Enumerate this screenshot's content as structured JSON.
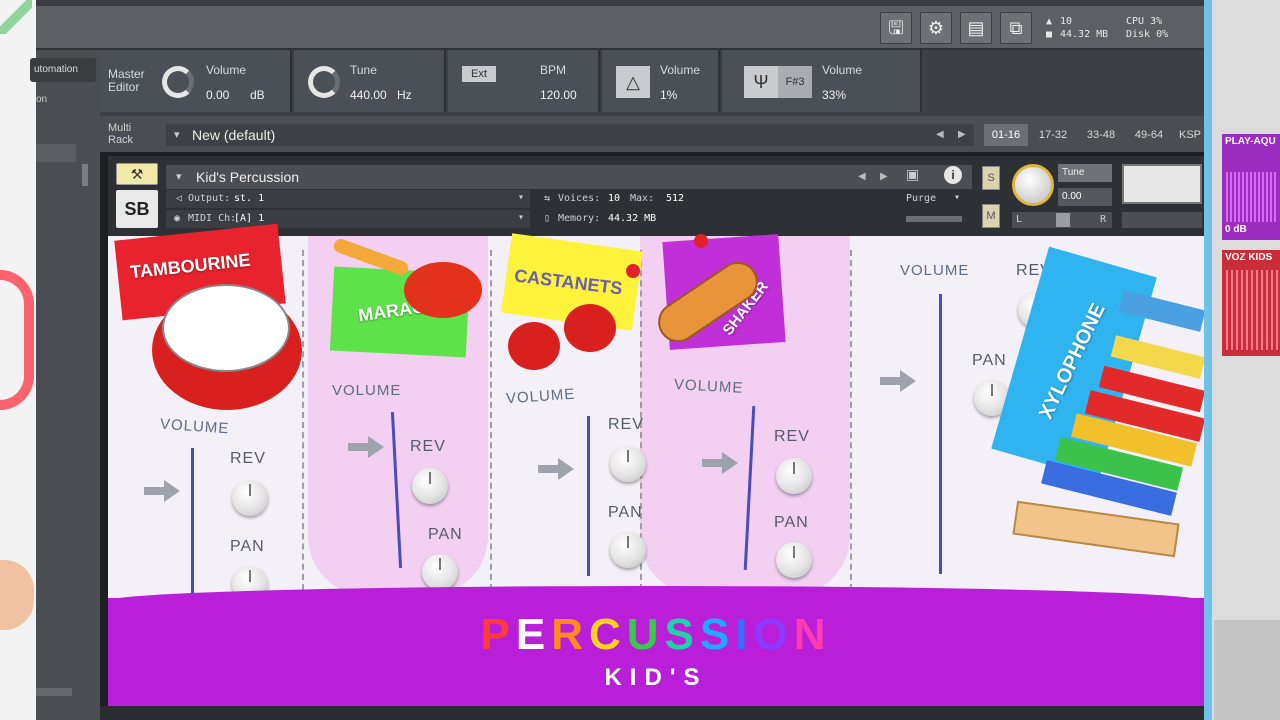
{
  "left": {
    "tab_label": "utomation",
    "sub_label": "on"
  },
  "topbar": {
    "voices_label": "10",
    "memory_label": "44.32 MB",
    "cpu_label": "CPU 3%",
    "disk_label": "Disk 0%"
  },
  "master": {
    "editor_label": "Master Editor",
    "volume_label": "Volume",
    "volume_value": "0.00",
    "volume_unit": "dB",
    "tune_label": "Tune",
    "tune_value": "440.00",
    "tune_unit": "Hz",
    "ext_label": "Ext",
    "bpm_label": "BPM",
    "bpm_value": "120.00",
    "metronome_volume_label": "Volume",
    "metronome_volume_value": "1%",
    "reference_key": "F#3",
    "reference_volume_label": "Volume",
    "reference_volume_value": "33%"
  },
  "rack": {
    "label": "Multi Rack",
    "name": "New (default)",
    "tabs": [
      "01-16",
      "17-32",
      "33-48",
      "49-64",
      "KSP"
    ]
  },
  "instrument": {
    "name": "Kid's Percussion",
    "output_label": "Output:",
    "output_value": "st. 1",
    "voices_label": "Voices:",
    "voices_value": "10",
    "max_label": "Max:",
    "max_value": "512",
    "midi_label": "MIDI Ch:",
    "midi_value": "[A] 1",
    "memory_label": "Memory:",
    "memory_value": "44.32 MB",
    "purge_label": "Purge",
    "solo_label": "S",
    "mute_label": "M",
    "tune_label": "Tune",
    "tune_value": "0.00",
    "left_label": "L",
    "right_label": "R"
  },
  "channels": [
    {
      "name": "TAMBOURINE",
      "volume_label": "VOLUME",
      "rev_label": "REV",
      "pan_label": "PAN"
    },
    {
      "name": "MARACA",
      "volume_label": "VOLUME",
      "rev_label": "REV",
      "pan_label": "PAN"
    },
    {
      "name": "CASTANETS",
      "volume_label": "VOLUME",
      "rev_label": "REV",
      "pan_label": "PAN"
    },
    {
      "name": "SHAKER",
      "volume_label": "VOLUME",
      "rev_label": "REV",
      "pan_label": "PAN"
    },
    {
      "name": "XYLOPHONE",
      "volume_label": "VOLUME",
      "rev_label": "REV",
      "pan_label": "PAN"
    }
  ],
  "footer": {
    "title_letters": [
      "P",
      "E",
      "R",
      "C",
      "U",
      "S",
      "S",
      "I",
      "O",
      "N"
    ],
    "title_colors": [
      "#ff3b3b",
      "#ffffff",
      "#ff8a1f",
      "#ffd21f",
      "#39c84a",
      "#1fd2a8",
      "#22a7ff",
      "#3a6bff",
      "#8a3bff",
      "#ff3bb0"
    ],
    "subtitle": "KID'S"
  },
  "right": {
    "clip1_label": "PLAY-AQU",
    "clip1_level": "0 dB",
    "clip2_label": "VOZ KIDS"
  }
}
